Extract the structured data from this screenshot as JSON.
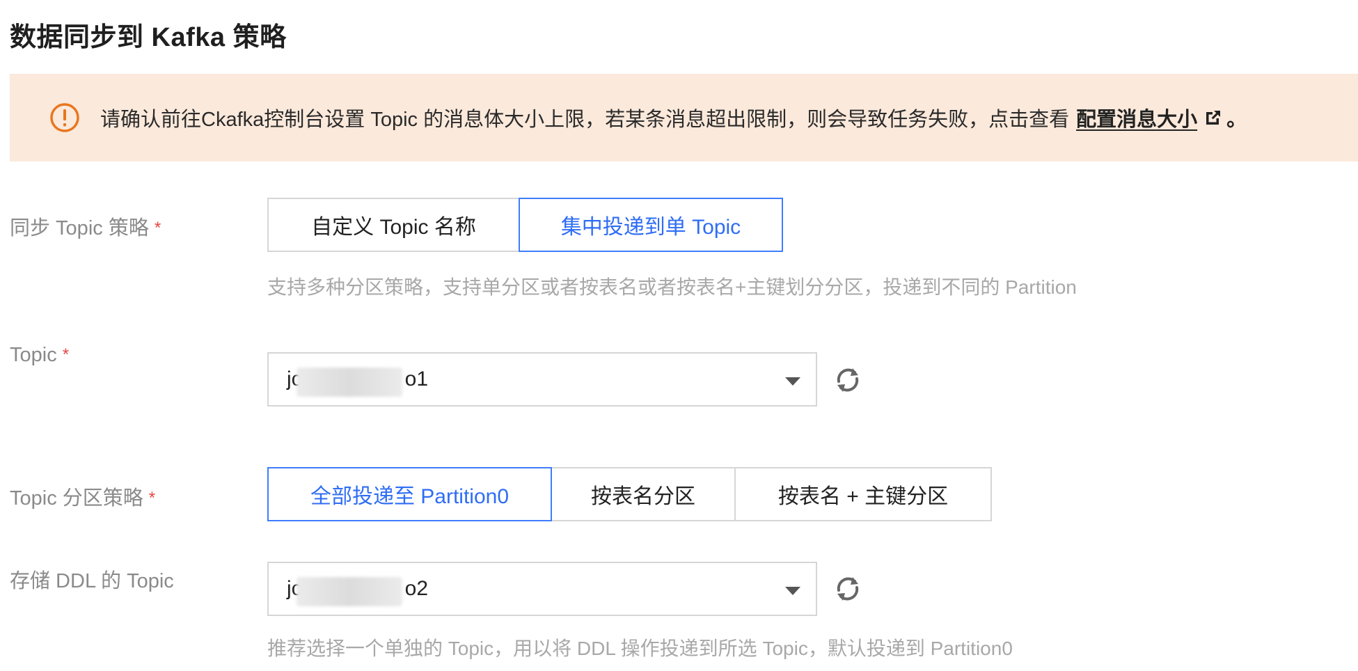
{
  "page": {
    "title": "数据同步到 Kafka 策略"
  },
  "notice": {
    "icon": "warning-circle-icon",
    "text": "请确认前往Ckafka控制台设置 Topic 的消息体大小上限，若某条消息超出限制，则会导致任务失败，点击查看",
    "link_label": "配置消息大小",
    "link_icon": "external-link-icon",
    "tail": "。",
    "color": "#fbe9db"
  },
  "sync_strategy": {
    "label": "同步 Topic 策略",
    "required_mark": "*",
    "options": [
      {
        "label": "自定义 Topic 名称",
        "active": false
      },
      {
        "label": "集中投递到单 Topic",
        "active": true
      }
    ],
    "hint": "支持多种分区策略，支持单分区或者按表名或者按表名+主键划分分区，投递到不同的 Partition"
  },
  "topic": {
    "label": "Topic",
    "required_mark": "*",
    "value_prefix": "jc",
    "value_suffix": "o1",
    "refresh_icon": "refresh-icon"
  },
  "partition_strategy": {
    "label": "Topic 分区策略",
    "required_mark": "*",
    "options": [
      {
        "label": "全部投递至 Partition0",
        "active": true
      },
      {
        "label": "按表名分区",
        "active": false
      },
      {
        "label": "按表名 + 主键分区",
        "active": false
      }
    ]
  },
  "ddl_topic": {
    "label": "存储 DDL 的 Topic",
    "value_prefix": "jc",
    "value_suffix": "o2",
    "refresh_icon": "refresh-icon",
    "hint": "推荐选择一个单独的 Topic，用以将 DDL 操作投递到所选 Topic，默认投递到 Partition0"
  },
  "colors": {
    "accent": "#3f7cff",
    "required": "#e54545",
    "warning": "#e8761f"
  }
}
